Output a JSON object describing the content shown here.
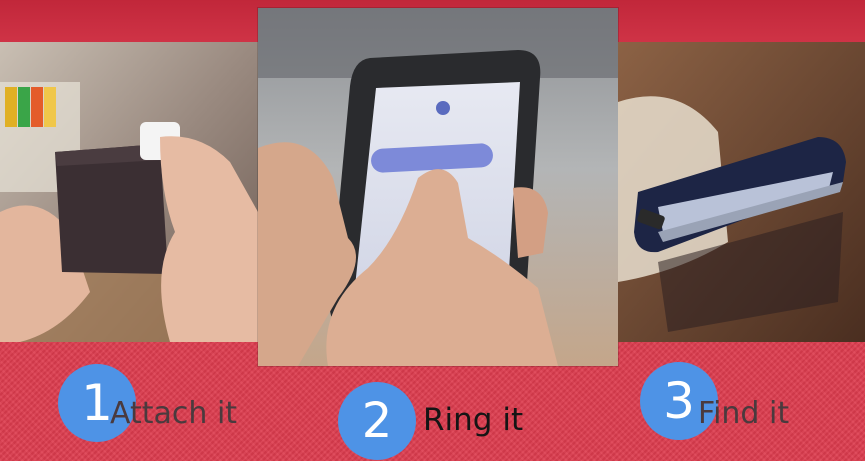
{
  "colors": {
    "brand_red": "#dd3c4e",
    "circle_blue": "#4e93e6",
    "circle_text": "#ffffff"
  },
  "steps": [
    {
      "number": "1",
      "label": "Attach it",
      "icon": "wallet-tag-photo"
    },
    {
      "number": "2",
      "label": "Ring it",
      "icon": "phone-app-photo"
    },
    {
      "number": "3",
      "label": "Find it",
      "icon": "found-wallet-photo"
    }
  ]
}
